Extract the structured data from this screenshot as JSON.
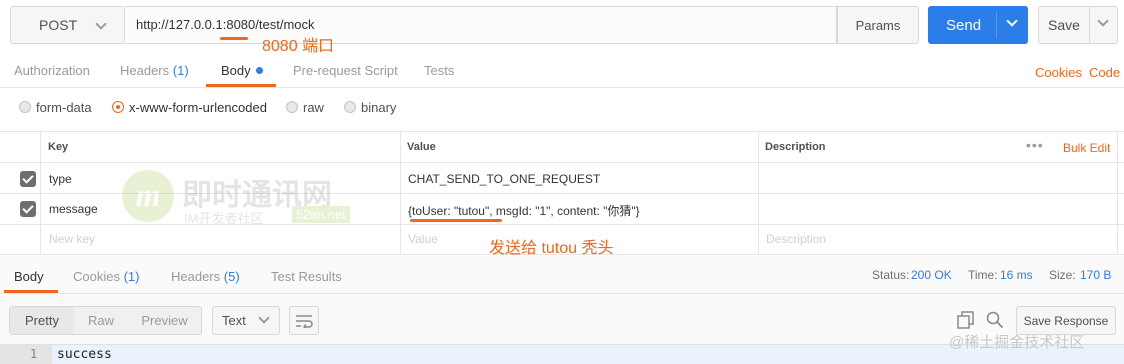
{
  "request": {
    "method": "POST",
    "url": "http://127.0.0.1:8080/test/mock",
    "params_label": "Params",
    "send_label": "Send",
    "save_label": "Save"
  },
  "annotations": {
    "port": "8080 端口",
    "send_to": "发送给 tutou 秃头"
  },
  "request_tabs": {
    "authorization": "Authorization",
    "headers": "Headers",
    "headers_count": "(1)",
    "body": "Body",
    "prerequest": "Pre-request Script",
    "tests": "Tests",
    "cookies": "Cookies",
    "code": "Code"
  },
  "body_types": [
    "form-data",
    "x-www-form-urlencoded",
    "raw",
    "binary"
  ],
  "table": {
    "key_header": "Key",
    "value_header": "Value",
    "description_header": "Description",
    "bulk_edit": "Bulk Edit",
    "rows": [
      {
        "key": "type",
        "value": "CHAT_SEND_TO_ONE_REQUEST"
      },
      {
        "key": "message",
        "value": "{toUser: \"tutou\", msgId: \"1\", content: \"你猜\"}"
      }
    ],
    "placeholder_key": "New key",
    "placeholder_value": "Value",
    "placeholder_description": "Description"
  },
  "watermark": {
    "brand": "即时通讯网",
    "tagline": "IM开发者社区",
    "domain": "52im.net"
  },
  "response_tabs": {
    "body": "Body",
    "cookies": "Cookies",
    "cookies_count": "(1)",
    "headers": "Headers",
    "headers_count": "(5)",
    "test_results": "Test Results"
  },
  "response_meta": {
    "status_label": "Status:",
    "status_value": "200 OK",
    "time_label": "Time:",
    "time_value": "16 ms",
    "size_label": "Size:",
    "size_value": "170 B"
  },
  "response_toolbar": {
    "pretty": "Pretty",
    "raw": "Raw",
    "preview": "Preview",
    "format": "Text",
    "save_response": "Save Response"
  },
  "response_body": {
    "line_number": "1",
    "content": "success"
  },
  "juejin_watermark": "@稀土掘金技术社区",
  "colors": {
    "accent": "#f0671e",
    "send": "#2b7de9"
  }
}
